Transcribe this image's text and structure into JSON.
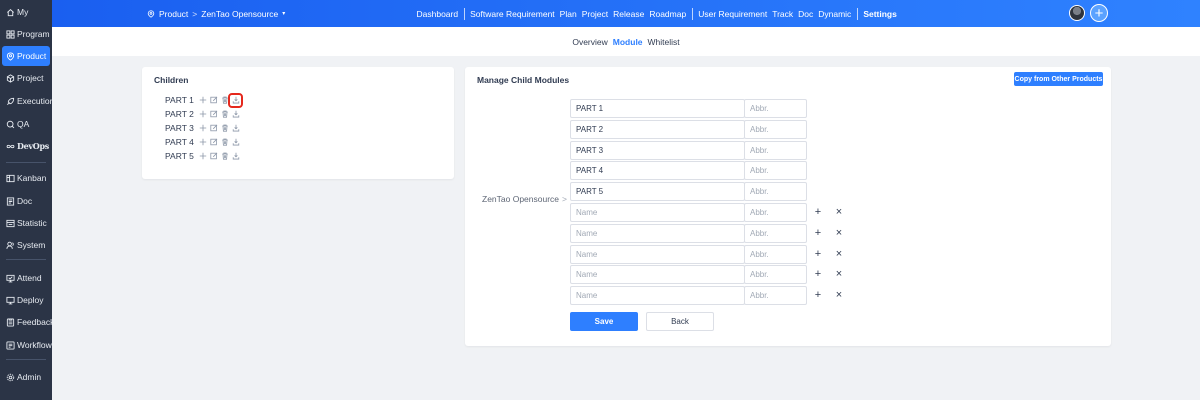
{
  "sidebar": {
    "items": [
      {
        "label": "My",
        "icon": "home-icon"
      },
      {
        "label": "Program",
        "icon": "grid-icon"
      },
      {
        "label": "Product",
        "icon": "product-icon"
      },
      {
        "label": "Project",
        "icon": "project-icon"
      },
      {
        "label": "Execution",
        "icon": "execution-icon"
      },
      {
        "label": "QA",
        "icon": "qa-icon"
      },
      {
        "label": "DevOps",
        "icon": "infinity-icon"
      },
      {
        "label": "Kanban",
        "icon": "kanban-icon"
      },
      {
        "label": "Doc",
        "icon": "doc-icon"
      },
      {
        "label": "Statistic",
        "icon": "statistic-icon"
      },
      {
        "label": "System",
        "icon": "system-icon"
      },
      {
        "label": "Attend",
        "icon": "attend-icon"
      },
      {
        "label": "Deploy",
        "icon": "deploy-icon"
      },
      {
        "label": "Feedback",
        "icon": "feedback-icon"
      },
      {
        "label": "Workflow",
        "icon": "workflow-icon"
      },
      {
        "label": "Admin",
        "icon": "admin-icon"
      }
    ]
  },
  "topbar": {
    "breadcrumb_product": "Product",
    "breadcrumb_sep": ">",
    "breadcrumb_current": "ZenTao Opensource",
    "nav": [
      "Dashboard",
      "Software Requirement",
      "Plan",
      "Project",
      "Release",
      "Roadmap",
      "User Requirement",
      "Track",
      "Doc",
      "Dynamic",
      "Settings"
    ],
    "plus_label": "+"
  },
  "subnav": {
    "tabs": [
      "Overview",
      "Module",
      "Whitelist"
    ]
  },
  "children": {
    "title": "Children",
    "items": [
      "PART 1",
      "PART 2",
      "PART 3",
      "PART 4",
      "PART 5"
    ]
  },
  "manage": {
    "title": "Manage Child Modules",
    "copy_button": "Copy from Other Products",
    "parent": "ZenTao Opensource",
    "parent_chevron": ">",
    "name_placeholder": "Name",
    "abbr_placeholder": "Abbr.",
    "existing": [
      "PART 1",
      "PART 2",
      "PART 3",
      "PART 4",
      "PART 5"
    ],
    "new_rows": 5,
    "add_symbol": "+",
    "remove_symbol": "×",
    "save_button": "Save",
    "back_button": "Back"
  },
  "colors": {
    "accent": "#2e7fff",
    "sidebar_bg": "#2b3446",
    "highlight": "#e5281d"
  }
}
